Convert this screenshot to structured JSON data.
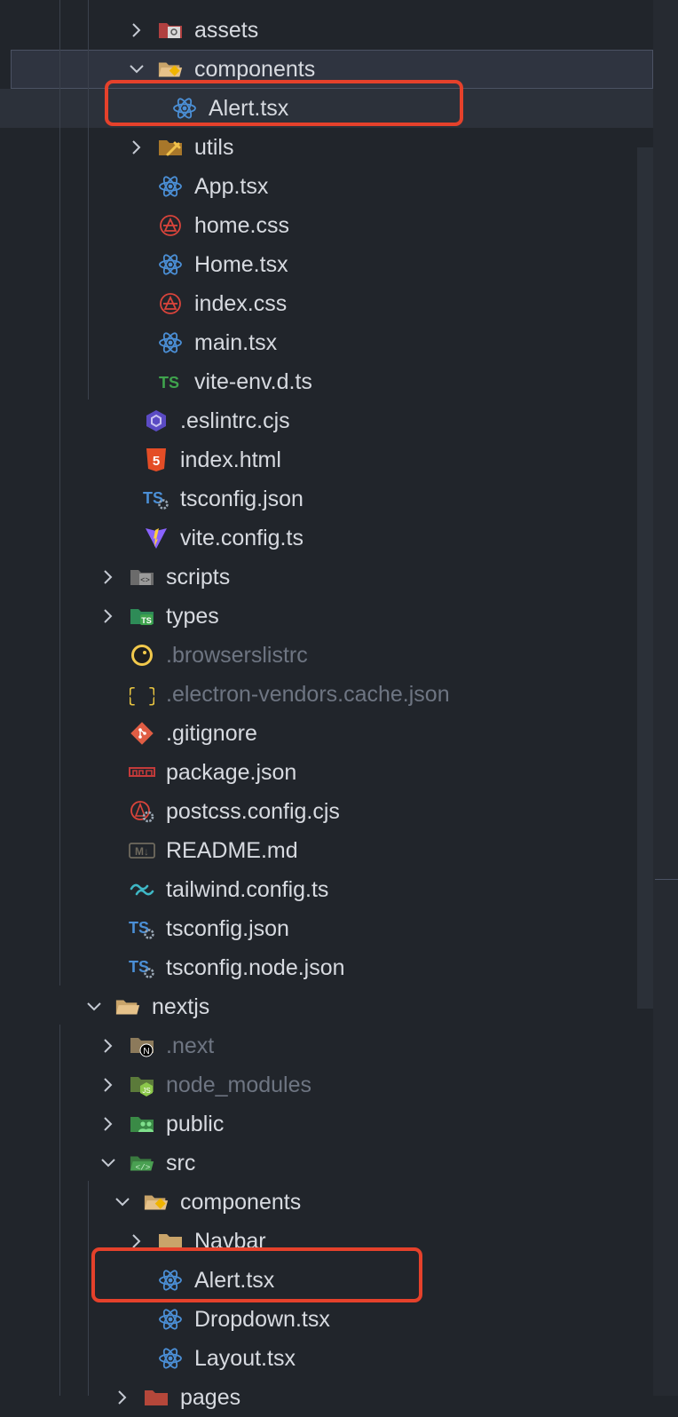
{
  "tree": {
    "rows": [
      {
        "label": "assets",
        "chevron": "right",
        "icon": "assets-folder-icon",
        "indent": 2
      },
      {
        "label": "components",
        "chevron": "down",
        "icon": "components-folder-icon",
        "indent": 2,
        "state": "selected"
      },
      {
        "label": "Alert.tsx",
        "chevron": "none",
        "icon": "react-icon",
        "indent": 3,
        "state": "hover"
      },
      {
        "label": "utils",
        "chevron": "right",
        "icon": "utils-folder-icon",
        "indent": 2
      },
      {
        "label": "App.tsx",
        "chevron": "none",
        "icon": "react-icon",
        "indent": 2
      },
      {
        "label": "home.css",
        "chevron": "none",
        "icon": "css-icon",
        "indent": 2
      },
      {
        "label": "Home.tsx",
        "chevron": "none",
        "icon": "react-icon",
        "indent": 2
      },
      {
        "label": "index.css",
        "chevron": "none",
        "icon": "css-icon",
        "indent": 2
      },
      {
        "label": "main.tsx",
        "chevron": "none",
        "icon": "react-icon",
        "indent": 2
      },
      {
        "label": "vite-env.d.ts",
        "chevron": "none",
        "icon": "typescript-icon",
        "indent": 2
      },
      {
        "label": ".eslintrc.cjs",
        "chevron": "none",
        "icon": "eslint-icon",
        "indent": 1
      },
      {
        "label": "index.html",
        "chevron": "none",
        "icon": "html5-icon",
        "indent": 1
      },
      {
        "label": "tsconfig.json",
        "chevron": "none",
        "icon": "tsconfig-icon",
        "indent": 1
      },
      {
        "label": "vite.config.ts",
        "chevron": "none",
        "icon": "vite-icon",
        "indent": 1
      },
      {
        "label": "scripts",
        "chevron": "right",
        "icon": "scripts-folder-icon",
        "indent": 0
      },
      {
        "label": "types",
        "chevron": "right",
        "icon": "types-folder-icon",
        "indent": 0
      },
      {
        "label": ".browserslistrc",
        "chevron": "none",
        "icon": "browserslist-icon",
        "indent": 0,
        "dim": true
      },
      {
        "label": ".electron-vendors.cache.json",
        "chevron": "none",
        "icon": "json-braces-icon",
        "indent": 0,
        "dim": true
      },
      {
        "label": ".gitignore",
        "chevron": "none",
        "icon": "git-icon",
        "indent": 0
      },
      {
        "label": "package.json",
        "chevron": "none",
        "icon": "npm-icon",
        "indent": 0
      },
      {
        "label": "postcss.config.cjs",
        "chevron": "none",
        "icon": "postcss-config-icon",
        "indent": 0
      },
      {
        "label": "README.md",
        "chevron": "none",
        "icon": "markdown-icon",
        "indent": 0
      },
      {
        "label": "tailwind.config.ts",
        "chevron": "none",
        "icon": "tailwind-icon",
        "indent": 0
      },
      {
        "label": "tsconfig.json",
        "chevron": "none",
        "icon": "tsconfig-icon",
        "indent": 0
      },
      {
        "label": "tsconfig.node.json",
        "chevron": "none",
        "icon": "tsconfig-icon",
        "indent": 0
      },
      {
        "label": "nextjs",
        "chevron": "down",
        "icon": "folder-open-icon",
        "indent": -1
      },
      {
        "label": ".next",
        "chevron": "right",
        "icon": "next-folder-icon",
        "indent": 0,
        "dim": true
      },
      {
        "label": "node_modules",
        "chevron": "right",
        "icon": "node-modules-folder-icon",
        "indent": 0,
        "dim": true
      },
      {
        "label": "public",
        "chevron": "right",
        "icon": "public-folder-icon",
        "indent": 0
      },
      {
        "label": "src",
        "chevron": "down",
        "icon": "src-folder-icon",
        "indent": 0
      },
      {
        "label": "components",
        "chevron": "down",
        "icon": "components-folder-icon",
        "indent": 1
      },
      {
        "label": "Navbar",
        "chevron": "right",
        "icon": "folder-icon",
        "indent": 2
      },
      {
        "label": "Alert.tsx",
        "chevron": "none",
        "icon": "react-icon",
        "indent": 2
      },
      {
        "label": "Dropdown.tsx",
        "chevron": "none",
        "icon": "react-icon",
        "indent": 2
      },
      {
        "label": "Layout.tsx",
        "chevron": "none",
        "icon": "react-icon",
        "indent": 2
      },
      {
        "label": "pages",
        "chevron": "right",
        "icon": "pages-folder-icon",
        "indent": 1
      }
    ]
  },
  "colors": {
    "background": "#21252b",
    "text": "#d7dae0",
    "dim_text": "#6e7582",
    "highlight_box": "#e5412b",
    "react": "#4b8fd6",
    "css": "#d9443b",
    "typescript": "#3fa34d"
  }
}
